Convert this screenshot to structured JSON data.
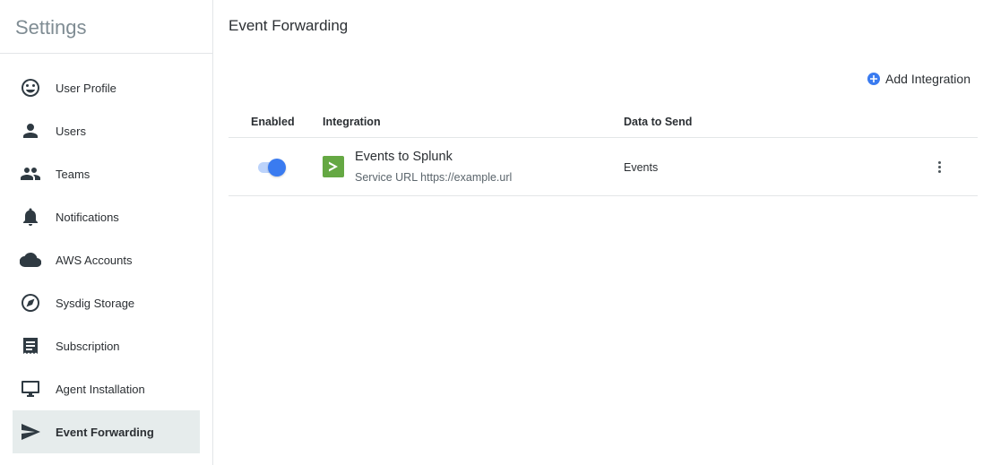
{
  "sidebar": {
    "title": "Settings",
    "items": [
      {
        "label": "User Profile",
        "icon": "smiley-face-icon"
      },
      {
        "label": "Users",
        "icon": "person-icon"
      },
      {
        "label": "Teams",
        "icon": "people-icon"
      },
      {
        "label": "Notifications",
        "icon": "bell-icon"
      },
      {
        "label": "AWS Accounts",
        "icon": "cloud-icon"
      },
      {
        "label": "Sysdig Storage",
        "icon": "storage-icon"
      },
      {
        "label": "Subscription",
        "icon": "receipt-icon"
      },
      {
        "label": "Agent Installation",
        "icon": "monitor-icon"
      },
      {
        "label": "Event Forwarding",
        "icon": "send-icon",
        "active": true
      }
    ]
  },
  "main": {
    "title": "Event Forwarding",
    "add_button_label": "Add Integration",
    "table": {
      "headers": {
        "enabled": "Enabled",
        "integration": "Integration",
        "data": "Data to Send"
      },
      "rows": [
        {
          "enabled": true,
          "name": "Events to Splunk",
          "service_url": "Service URL https://example.url",
          "data_to_send": "Events",
          "icon": "splunk-icon"
        }
      ]
    }
  },
  "colors": {
    "accent": "#3a7bf0",
    "splunk_green": "#65a843",
    "active_nav_bg": "#e6ecec"
  }
}
